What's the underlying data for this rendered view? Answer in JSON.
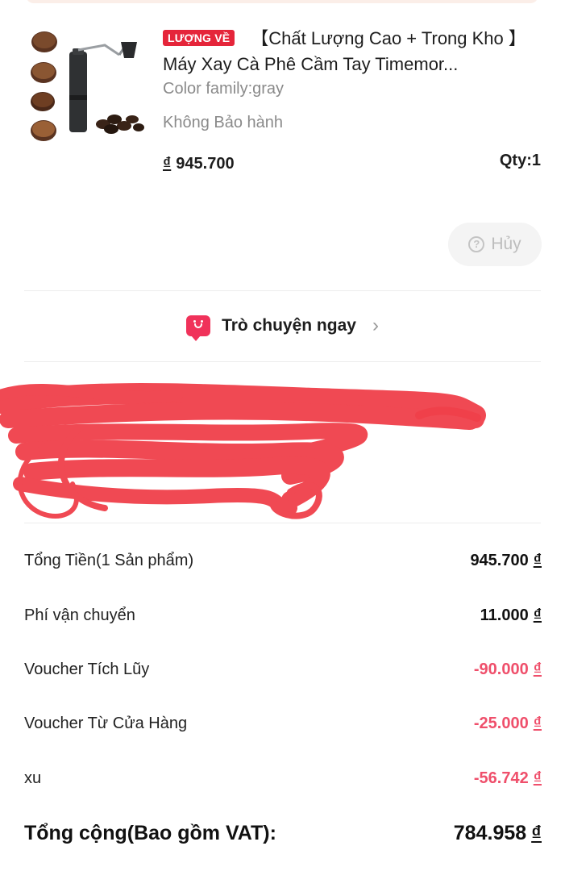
{
  "product": {
    "badge": "LƯỢNG VỀ",
    "title": "【Chất Lượng Cao + Trong Kho 】 Máy Xay Cà Phê Cầm Tay Timemor...",
    "variant": "Color family:gray",
    "warranty": "Không Bảo hành",
    "currency": "₫",
    "price": "945.700",
    "qty": "Qty:1"
  },
  "actions": {
    "cancel_icon": "?",
    "cancel_label": "Hủy"
  },
  "chat": {
    "label": "Trò chuyện ngay",
    "chevron": "›"
  },
  "summary": {
    "currency": "₫",
    "subtotal_label": "Tổng Tiền(1 Sản phẩm)",
    "subtotal_value": "945.700",
    "shipping_label": "Phí vận chuyển",
    "shipping_value": "11.000",
    "voucher_loyalty_label": "Voucher Tích Lũy",
    "voucher_loyalty_value": "-90.000",
    "voucher_store_label": "Voucher Từ Cửa Hàng",
    "voucher_store_value": "-25.000",
    "coins_label": "xu",
    "coins_value": "-56.742",
    "total_label": "Tổng cộng(Bao gồm VAT):",
    "total_value": "784.958"
  },
  "colors": {
    "accent": "#f0325a",
    "discount": "#ef4f6b",
    "badge": "#e5253a",
    "redaction": "#f0404a"
  }
}
